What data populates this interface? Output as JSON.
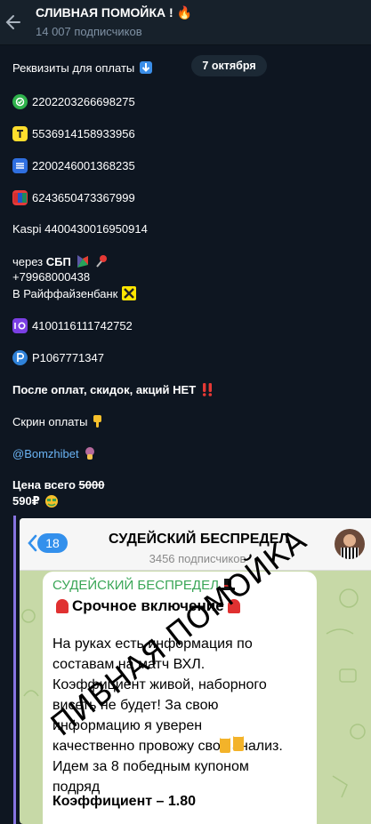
{
  "header": {
    "title": "СЛИВНАЯ ПОМОЙКА ! 🔥",
    "subtitle": "14 007 подписчиков",
    "back_icon": "arrow-left-icon"
  },
  "date_pill": "7 октября",
  "message": {
    "requisites": "Реквизиты для оплаты",
    "cards": [
      {
        "icon": "green-check-bank-icon",
        "number": "2202203266698275"
      },
      {
        "icon": "tinkoff-yellow-icon",
        "number": "5536914158933956"
      },
      {
        "icon": "blue-bars-bank-icon",
        "number": "2200246001368235"
      },
      {
        "icon": "card-flag-icon",
        "number": "6243650473367999"
      }
    ],
    "kaspi": "Kaspi 4400430016950914",
    "sbp_prefix": "через",
    "sbp_bold": "СБП",
    "phone": "+79968000438",
    "raiffeisen": "В Райффайзенбанк",
    "yoomoney": "4100116111742752",
    "payeer": "P1067771347",
    "no_discounts": "После оплат, скидок, акций НЕТ",
    "screenshot_note": "Скрин оплаты",
    "username": "@Bomzhibet",
    "price_label": "Цена всего",
    "old_price": "5000",
    "new_price": "590₽"
  },
  "embedded": {
    "badge": "18",
    "title": "СУДЕЙСКИЙ БЕСПРЕДЕЛ",
    "subscribers": "3456 подписчиков",
    "bubble_channel": "СУДЕЙСКИЙ БЕСПРЕДЕЛ",
    "bubble_headline": "Срочное включение",
    "body_lines": [
      "На руках есть информация по",
      "составам на матч ВХЛ.",
      "Коэффициент живой, наборного",
      "висеть не будет! За свою",
      "информацию я уверен",
      "качественно провожу свой анализ.",
      "Идем за 8 победным купоном",
      "подряд"
    ],
    "coef_line": "Коэффициент – 1.80",
    "watermark": "ПИВНАЯ ПОМОЙКА"
  },
  "colors": {
    "background": "#0e1621",
    "header": "#17212b",
    "link": "#6ab3f3",
    "accent": "#8774e1"
  }
}
